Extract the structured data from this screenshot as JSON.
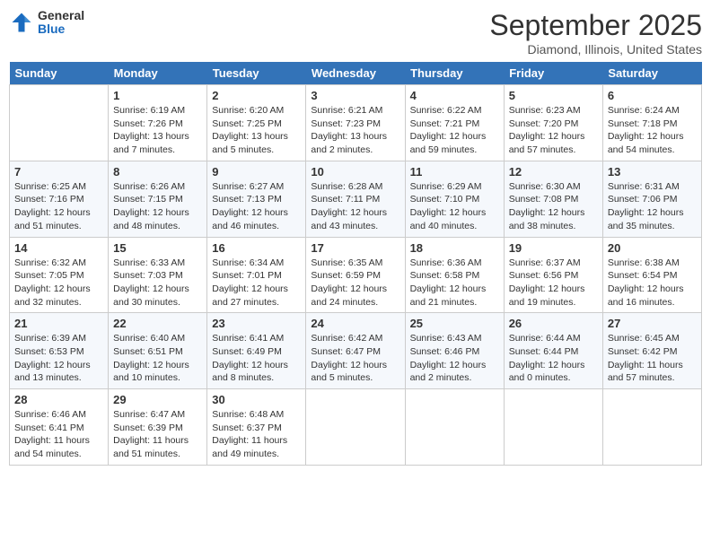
{
  "logo": {
    "general": "General",
    "blue": "Blue"
  },
  "header": {
    "month": "September 2025",
    "location": "Diamond, Illinois, United States"
  },
  "weekdays": [
    "Sunday",
    "Monday",
    "Tuesday",
    "Wednesday",
    "Thursday",
    "Friday",
    "Saturday"
  ],
  "weeks": [
    [
      {
        "day": "",
        "info": ""
      },
      {
        "day": "1",
        "info": "Sunrise: 6:19 AM\nSunset: 7:26 PM\nDaylight: 13 hours\nand 7 minutes."
      },
      {
        "day": "2",
        "info": "Sunrise: 6:20 AM\nSunset: 7:25 PM\nDaylight: 13 hours\nand 5 minutes."
      },
      {
        "day": "3",
        "info": "Sunrise: 6:21 AM\nSunset: 7:23 PM\nDaylight: 13 hours\nand 2 minutes."
      },
      {
        "day": "4",
        "info": "Sunrise: 6:22 AM\nSunset: 7:21 PM\nDaylight: 12 hours\nand 59 minutes."
      },
      {
        "day": "5",
        "info": "Sunrise: 6:23 AM\nSunset: 7:20 PM\nDaylight: 12 hours\nand 57 minutes."
      },
      {
        "day": "6",
        "info": "Sunrise: 6:24 AM\nSunset: 7:18 PM\nDaylight: 12 hours\nand 54 minutes."
      }
    ],
    [
      {
        "day": "7",
        "info": "Sunrise: 6:25 AM\nSunset: 7:16 PM\nDaylight: 12 hours\nand 51 minutes."
      },
      {
        "day": "8",
        "info": "Sunrise: 6:26 AM\nSunset: 7:15 PM\nDaylight: 12 hours\nand 48 minutes."
      },
      {
        "day": "9",
        "info": "Sunrise: 6:27 AM\nSunset: 7:13 PM\nDaylight: 12 hours\nand 46 minutes."
      },
      {
        "day": "10",
        "info": "Sunrise: 6:28 AM\nSunset: 7:11 PM\nDaylight: 12 hours\nand 43 minutes."
      },
      {
        "day": "11",
        "info": "Sunrise: 6:29 AM\nSunset: 7:10 PM\nDaylight: 12 hours\nand 40 minutes."
      },
      {
        "day": "12",
        "info": "Sunrise: 6:30 AM\nSunset: 7:08 PM\nDaylight: 12 hours\nand 38 minutes."
      },
      {
        "day": "13",
        "info": "Sunrise: 6:31 AM\nSunset: 7:06 PM\nDaylight: 12 hours\nand 35 minutes."
      }
    ],
    [
      {
        "day": "14",
        "info": "Sunrise: 6:32 AM\nSunset: 7:05 PM\nDaylight: 12 hours\nand 32 minutes."
      },
      {
        "day": "15",
        "info": "Sunrise: 6:33 AM\nSunset: 7:03 PM\nDaylight: 12 hours\nand 30 minutes."
      },
      {
        "day": "16",
        "info": "Sunrise: 6:34 AM\nSunset: 7:01 PM\nDaylight: 12 hours\nand 27 minutes."
      },
      {
        "day": "17",
        "info": "Sunrise: 6:35 AM\nSunset: 6:59 PM\nDaylight: 12 hours\nand 24 minutes."
      },
      {
        "day": "18",
        "info": "Sunrise: 6:36 AM\nSunset: 6:58 PM\nDaylight: 12 hours\nand 21 minutes."
      },
      {
        "day": "19",
        "info": "Sunrise: 6:37 AM\nSunset: 6:56 PM\nDaylight: 12 hours\nand 19 minutes."
      },
      {
        "day": "20",
        "info": "Sunrise: 6:38 AM\nSunset: 6:54 PM\nDaylight: 12 hours\nand 16 minutes."
      }
    ],
    [
      {
        "day": "21",
        "info": "Sunrise: 6:39 AM\nSunset: 6:53 PM\nDaylight: 12 hours\nand 13 minutes."
      },
      {
        "day": "22",
        "info": "Sunrise: 6:40 AM\nSunset: 6:51 PM\nDaylight: 12 hours\nand 10 minutes."
      },
      {
        "day": "23",
        "info": "Sunrise: 6:41 AM\nSunset: 6:49 PM\nDaylight: 12 hours\nand 8 minutes."
      },
      {
        "day": "24",
        "info": "Sunrise: 6:42 AM\nSunset: 6:47 PM\nDaylight: 12 hours\nand 5 minutes."
      },
      {
        "day": "25",
        "info": "Sunrise: 6:43 AM\nSunset: 6:46 PM\nDaylight: 12 hours\nand 2 minutes."
      },
      {
        "day": "26",
        "info": "Sunrise: 6:44 AM\nSunset: 6:44 PM\nDaylight: 12 hours\nand 0 minutes."
      },
      {
        "day": "27",
        "info": "Sunrise: 6:45 AM\nSunset: 6:42 PM\nDaylight: 11 hours\nand 57 minutes."
      }
    ],
    [
      {
        "day": "28",
        "info": "Sunrise: 6:46 AM\nSunset: 6:41 PM\nDaylight: 11 hours\nand 54 minutes."
      },
      {
        "day": "29",
        "info": "Sunrise: 6:47 AM\nSunset: 6:39 PM\nDaylight: 11 hours\nand 51 minutes."
      },
      {
        "day": "30",
        "info": "Sunrise: 6:48 AM\nSunset: 6:37 PM\nDaylight: 11 hours\nand 49 minutes."
      },
      {
        "day": "",
        "info": ""
      },
      {
        "day": "",
        "info": ""
      },
      {
        "day": "",
        "info": ""
      },
      {
        "day": "",
        "info": ""
      }
    ]
  ]
}
